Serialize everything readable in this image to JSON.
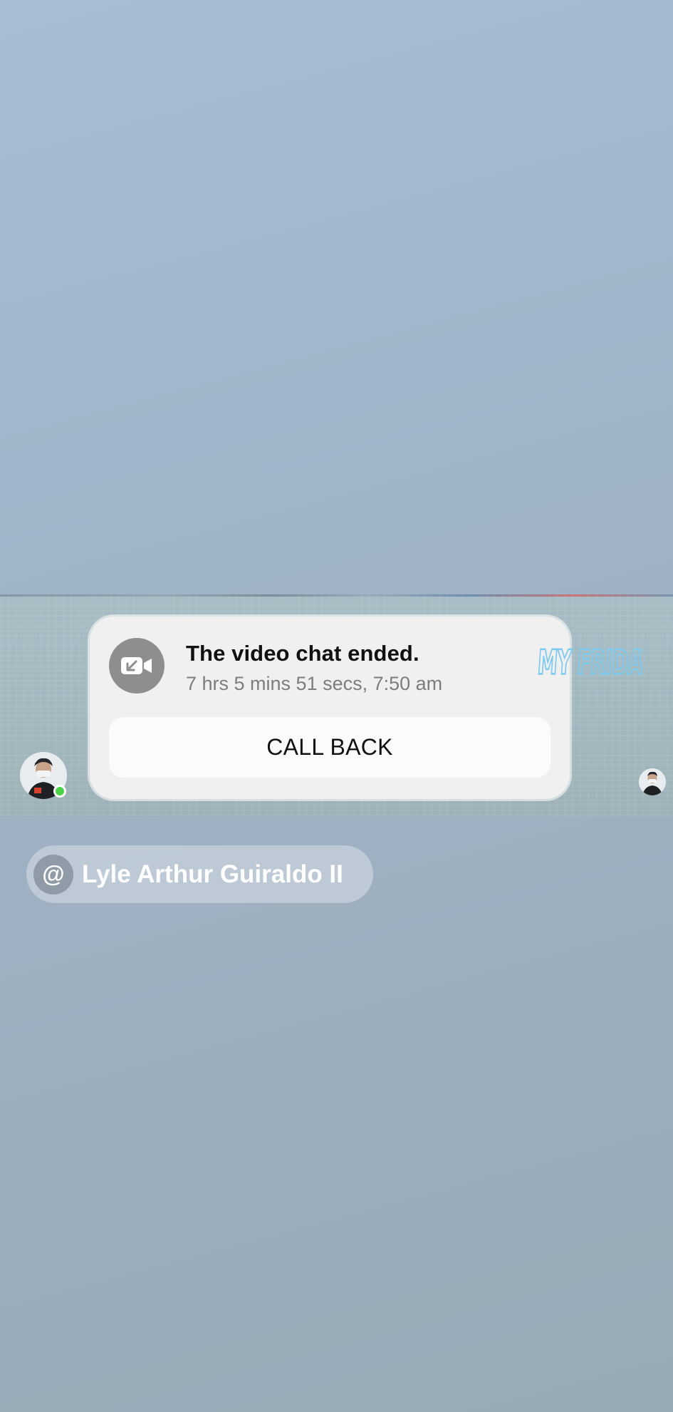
{
  "video_chat": {
    "title": "The video chat ended.",
    "subtitle": "7 hrs 5 mins 51 secs, 7:50 am",
    "call_back_label": "CALL BACK",
    "icon": "video-camera-incoming-icon"
  },
  "sticker": {
    "text": "MY FRIDAY",
    "color": "#7ec9ee"
  },
  "participants": {
    "left_avatar_status": "online",
    "online_color": "#4cd34a"
  },
  "mention": {
    "symbol": "@",
    "name": "Lyle Arthur Guiraldo II"
  }
}
